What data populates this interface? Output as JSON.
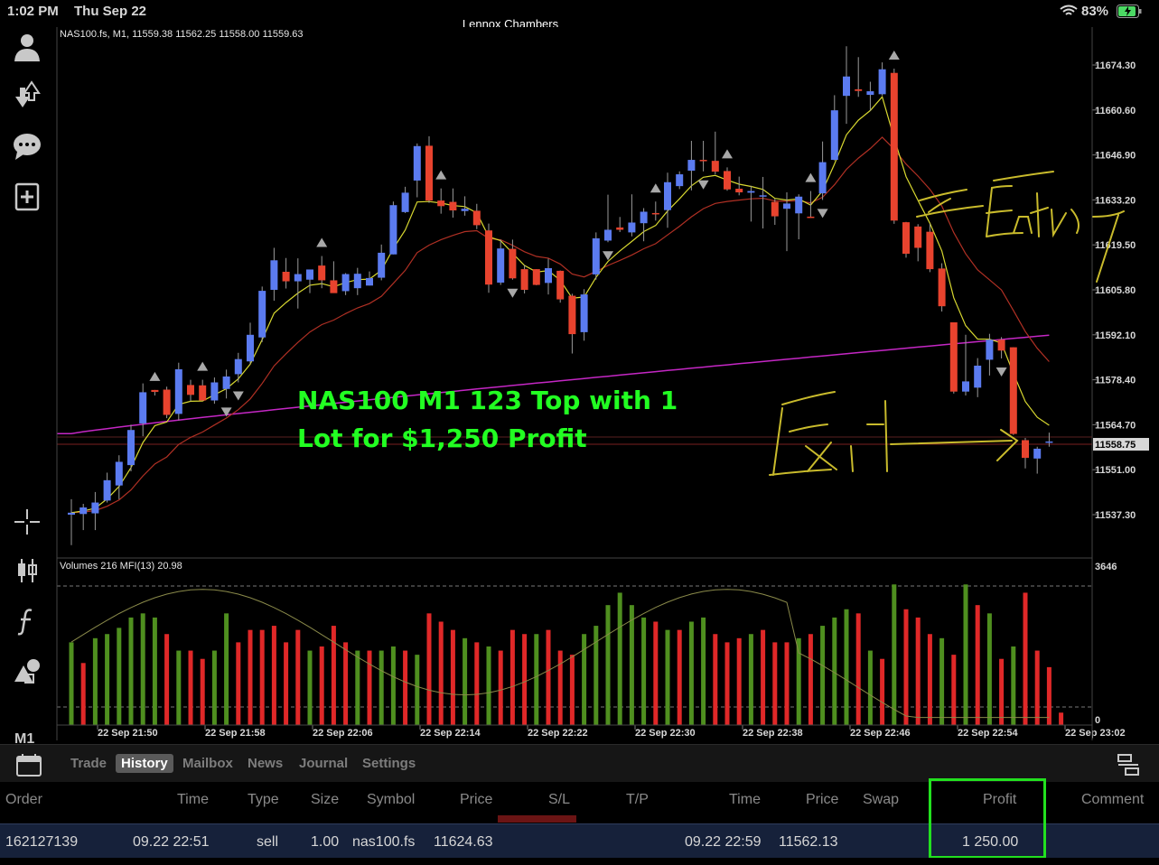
{
  "status_bar": {
    "time": "1:02 PM",
    "date": "Thu Sep 22",
    "user": "Lennox Chambers",
    "battery": "83%"
  },
  "toolbar": {
    "icons": [
      "account-icon",
      "trade-arrows-icon",
      "chat-icon",
      "new-order-icon",
      "crosshair-icon",
      "indicators-icon",
      "function-icon",
      "objects-icon"
    ],
    "timeframe": "M1"
  },
  "chart": {
    "header": "NAS100.fs, M1, 11559.38 11562.25 11558.00 11559.63",
    "indicator_header": "Volumes 216 MFI(13) 20.98",
    "annotation": "NAS100 M1 123 Top with 1 Lot for $1,250 Profit",
    "price_labels": [
      "11674.30",
      "11660.60",
      "11646.90",
      "11633.20",
      "11619.50",
      "11605.80",
      "11592.10",
      "11578.40",
      "11564.70",
      "11551.00",
      "11537.30"
    ],
    "current_price_label": "11558.75",
    "volume_max_label": "3646",
    "volume_zero_label": "0",
    "time_labels": [
      "22 Sep 21:50",
      "22 Sep 21:58",
      "22 Sep 22:06",
      "22 Sep 22:14",
      "22 Sep 22:22",
      "22 Sep 22:30",
      "22 Sep 22:38",
      "22 Sep 22:46",
      "22 Sep 22:54",
      "22 Sep 23:02"
    ],
    "handwriting": [
      "Entry",
      "Exit"
    ],
    "colors": {
      "bull": "#5b7bf0",
      "bear": "#e8432e",
      "ma_fast": "#d8d830",
      "ma_mid": "#b03024",
      "ma_slow": "#c427c4",
      "vol_up": "#4f8f1f",
      "vol_down": "#e02828",
      "annotation": "#22ff22",
      "ink": "#c9bb2c"
    }
  },
  "chart_data": {
    "type": "candlestick",
    "symbol": "NAS100.fs",
    "timeframe": "M1",
    "ylim": [
      11530,
      11680
    ],
    "candles": [
      {
        "o": 11537.3,
        "h": 11542.0,
        "l": 11528.0,
        "c": 11537.9
      },
      {
        "o": 11537.5,
        "h": 11540.6,
        "l": 11532.6,
        "c": 11539.5
      },
      {
        "o": 11537.7,
        "h": 11544.2,
        "l": 11532.6,
        "c": 11541.0
      },
      {
        "o": 11541.6,
        "h": 11550.1,
        "l": 11541.0,
        "c": 11547.8
      },
      {
        "o": 11546.2,
        "h": 11555.4,
        "l": 11542.0,
        "c": 11553.4
      },
      {
        "o": 11552.4,
        "h": 11564.7,
        "l": 11550.5,
        "c": 11563.1
      },
      {
        "o": 11565.1,
        "h": 11577.3,
        "l": 11561.2,
        "c": 11574.6
      },
      {
        "o": 11575.3,
        "h": 11575.3,
        "l": 11573.6,
        "c": 11574.7
      },
      {
        "o": 11575.4,
        "h": 11576.3,
        "l": 11566.7,
        "c": 11567.7
      },
      {
        "o": 11568.0,
        "h": 11583.6,
        "l": 11566.0,
        "c": 11581.6
      },
      {
        "o": 11576.8,
        "h": 11578.4,
        "l": 11571.9,
        "c": 11573.8
      },
      {
        "o": 11576.7,
        "h": 11578.4,
        "l": 11572.0,
        "c": 11572.1
      },
      {
        "o": 11572.1,
        "h": 11579.1,
        "l": 11571.1,
        "c": 11577.6
      },
      {
        "o": 11575.6,
        "h": 11581.5,
        "l": 11572.7,
        "c": 11579.4
      },
      {
        "o": 11580.1,
        "h": 11586.6,
        "l": 11577.6,
        "c": 11584.7
      },
      {
        "o": 11584.0,
        "h": 11595.8,
        "l": 11583.2,
        "c": 11592.1
      },
      {
        "o": 11591.3,
        "h": 11606.8,
        "l": 11589.9,
        "c": 11605.5
      },
      {
        "o": 11605.8,
        "h": 11618.6,
        "l": 11602.5,
        "c": 11614.8
      },
      {
        "o": 11611.3,
        "h": 11615.5,
        "l": 11606.2,
        "c": 11608.4
      },
      {
        "o": 11608.4,
        "h": 11615.4,
        "l": 11600.1,
        "c": 11610.6
      },
      {
        "o": 11608.9,
        "h": 11612.0,
        "l": 11604.8,
        "c": 11612.0
      },
      {
        "o": 11613.2,
        "h": 11616.1,
        "l": 11606.3,
        "c": 11608.7
      },
      {
        "o": 11608.7,
        "h": 11614.5,
        "l": 11605.6,
        "c": 11604.8
      },
      {
        "o": 11605.4,
        "h": 11610.9,
        "l": 11604.2,
        "c": 11610.6
      },
      {
        "o": 11606.3,
        "h": 11612.5,
        "l": 11604.2,
        "c": 11610.7
      },
      {
        "o": 11607.1,
        "h": 11611.4,
        "l": 11607.1,
        "c": 11609.4
      },
      {
        "o": 11609.5,
        "h": 11619.6,
        "l": 11608.7,
        "c": 11617.1
      },
      {
        "o": 11616.6,
        "h": 11632.7,
        "l": 11616.6,
        "c": 11631.6
      },
      {
        "o": 11629.5,
        "h": 11637.2,
        "l": 11629.2,
        "c": 11635.4
      },
      {
        "o": 11639.1,
        "h": 11650.4,
        "l": 11634.0,
        "c": 11649.6
      },
      {
        "o": 11649.7,
        "h": 11652.6,
        "l": 11632.3,
        "c": 11633.0
      },
      {
        "o": 11633.0,
        "h": 11636.7,
        "l": 11629.0,
        "c": 11631.3
      },
      {
        "o": 11632.6,
        "h": 11636.7,
        "l": 11627.8,
        "c": 11630.0
      },
      {
        "o": 11629.8,
        "h": 11634.3,
        "l": 11628.4,
        "c": 11630.5
      },
      {
        "o": 11629.9,
        "h": 11632.0,
        "l": 11624.3,
        "c": 11625.5
      },
      {
        "o": 11623.9,
        "h": 11626.0,
        "l": 11604.9,
        "c": 11607.4
      },
      {
        "o": 11608.0,
        "h": 11621.1,
        "l": 11607.3,
        "c": 11618.4
      },
      {
        "o": 11618.3,
        "h": 11621.1,
        "l": 11608.9,
        "c": 11609.3
      },
      {
        "o": 11612.1,
        "h": 11613.4,
        "l": 11604.7,
        "c": 11605.8
      },
      {
        "o": 11612.1,
        "h": 11612.1,
        "l": 11607.2,
        "c": 11607.3
      },
      {
        "o": 11607.9,
        "h": 11615.3,
        "l": 11604.4,
        "c": 11612.4
      },
      {
        "o": 11611.6,
        "h": 11611.7,
        "l": 11601.9,
        "c": 11602.9
      },
      {
        "o": 11604.0,
        "h": 11604.6,
        "l": 11586.4,
        "c": 11592.3
      },
      {
        "o": 11592.9,
        "h": 11606.0,
        "l": 11590.3,
        "c": 11604.4
      },
      {
        "o": 11610.5,
        "h": 11623.3,
        "l": 11608.9,
        "c": 11621.5
      },
      {
        "o": 11620.8,
        "h": 11634.8,
        "l": 11620.3,
        "c": 11624.1
      },
      {
        "o": 11624.8,
        "h": 11628.0,
        "l": 11623.4,
        "c": 11624.1
      },
      {
        "o": 11623.3,
        "h": 11634.9,
        "l": 11622.1,
        "c": 11626.3
      },
      {
        "o": 11626.1,
        "h": 11630.7,
        "l": 11620.6,
        "c": 11629.6
      },
      {
        "o": 11629.2,
        "h": 11632.7,
        "l": 11626.9,
        "c": 11629.1
      },
      {
        "o": 11630.1,
        "h": 11641.5,
        "l": 11624.7,
        "c": 11638.6
      },
      {
        "o": 11637.4,
        "h": 11641.9,
        "l": 11636.5,
        "c": 11641.0
      },
      {
        "o": 11642.1,
        "h": 11651.2,
        "l": 11636.1,
        "c": 11645.4
      },
      {
        "o": 11645.4,
        "h": 11651.2,
        "l": 11641.9,
        "c": 11645.3
      },
      {
        "o": 11645.1,
        "h": 11654.0,
        "l": 11641.0,
        "c": 11641.8
      },
      {
        "o": 11642.0,
        "h": 11643.1,
        "l": 11636.0,
        "c": 11636.4
      },
      {
        "o": 11636.6,
        "h": 11640.3,
        "l": 11634.6,
        "c": 11635.5
      },
      {
        "o": 11635.4,
        "h": 11637.5,
        "l": 11626.6,
        "c": 11635.9
      },
      {
        "o": 11634.4,
        "h": 11640.2,
        "l": 11624.5,
        "c": 11634.6
      },
      {
        "o": 11632.6,
        "h": 11633.5,
        "l": 11625.6,
        "c": 11628.2
      },
      {
        "o": 11630.5,
        "h": 11635.5,
        "l": 11617.6,
        "c": 11632.1
      },
      {
        "o": 11629.1,
        "h": 11634.9,
        "l": 11621.2,
        "c": 11634.2
      },
      {
        "o": 11628.1,
        "h": 11635.9,
        "l": 11627.7,
        "c": 11627.9
      },
      {
        "o": 11635.2,
        "h": 11651.0,
        "l": 11633.2,
        "c": 11644.7
      },
      {
        "o": 11645.4,
        "h": 11665.1,
        "l": 11645.2,
        "c": 11660.5
      },
      {
        "o": 11664.9,
        "h": 11680.0,
        "l": 11656.4,
        "c": 11670.8
      },
      {
        "o": 11666.9,
        "h": 11676.7,
        "l": 11664.6,
        "c": 11666.4
      },
      {
        "o": 11665.2,
        "h": 11669.2,
        "l": 11660.4,
        "c": 11666.3
      },
      {
        "o": 11665.4,
        "h": 11675.1,
        "l": 11665.0,
        "c": 11673.0
      },
      {
        "o": 11671.9,
        "h": 11673.2,
        "l": 11625.9,
        "c": 11626.9
      },
      {
        "o": 11626.4,
        "h": 11626.5,
        "l": 11615.6,
        "c": 11616.8
      },
      {
        "o": 11625.1,
        "h": 11625.8,
        "l": 11614.5,
        "c": 11618.6
      },
      {
        "o": 11623.5,
        "h": 11625.9,
        "l": 11611.2,
        "c": 11612.1
      },
      {
        "o": 11612.3,
        "h": 11613.9,
        "l": 11599.2,
        "c": 11600.8
      },
      {
        "o": 11595.9,
        "h": 11595.9,
        "l": 11574.2,
        "c": 11574.8
      },
      {
        "o": 11574.8,
        "h": 11592.1,
        "l": 11573.6,
        "c": 11577.9
      },
      {
        "o": 11576.0,
        "h": 11585.0,
        "l": 11573.1,
        "c": 11582.7
      },
      {
        "o": 11584.5,
        "h": 11592.4,
        "l": 11579.7,
        "c": 11590.6
      },
      {
        "o": 11590.6,
        "h": 11591.4,
        "l": 11584.9,
        "c": 11587.3
      },
      {
        "o": 11588.3,
        "h": 11588.3,
        "l": 11561.6,
        "c": 11561.9
      },
      {
        "o": 11560.0,
        "h": 11560.7,
        "l": 11551.4,
        "c": 11554.6
      },
      {
        "o": 11554.4,
        "h": 11558.0,
        "l": 11549.8,
        "c": 11557.4
      },
      {
        "o": 11559.4,
        "h": 11562.3,
        "l": 11558.0,
        "c": 11559.6
      }
    ],
    "volume_ylim": [
      0,
      3646
    ],
    "volumes": [
      2000,
      1500,
      2100,
      2200,
      2350,
      2600,
      2700,
      2600,
      2200,
      1800,
      1800,
      1600,
      1800,
      2700,
      2000,
      2300,
      2300,
      2400,
      2000,
      2300,
      1800,
      1900,
      2400,
      2000,
      1800,
      1800,
      1800,
      1900,
      1800,
      1700,
      2700,
      2500,
      2300,
      2100,
      2000,
      1900,
      1800,
      2300,
      2200,
      2200,
      2300,
      1800,
      1700,
      2200,
      2400,
      2900,
      3200,
      2900,
      2600,
      2500,
      2300,
      2300,
      2500,
      2600,
      2200,
      2000,
      2100,
      2200,
      2300,
      2000,
      2000,
      2100,
      2200,
      2400,
      2600,
      2800,
      2700,
      1800,
      1600,
      3400,
      2800,
      2600,
      2200,
      2100,
      1700,
      3400,
      2900,
      2700,
      1600,
      1900,
      3200,
      1800,
      1400,
      300
    ],
    "volume_directions": [
      "up",
      "down",
      "up",
      "up",
      "up",
      "up",
      "up",
      "up",
      "down",
      "up",
      "down",
      "down",
      "up",
      "up",
      "down",
      "down",
      "down",
      "down",
      "down",
      "down",
      "up",
      "down",
      "down",
      "down",
      "up",
      "down",
      "up",
      "up",
      "down",
      "up",
      "down",
      "down",
      "down",
      "up",
      "down",
      "up",
      "down",
      "down",
      "down",
      "up",
      "down",
      "down",
      "down",
      "up",
      "up",
      "up",
      "up",
      "up",
      "up",
      "down",
      "up",
      "down",
      "up",
      "up",
      "down",
      "down",
      "down",
      "up",
      "down",
      "down",
      "down",
      "up",
      "down",
      "up",
      "up",
      "up",
      "down",
      "up",
      "down",
      "up",
      "down",
      "down",
      "down",
      "up",
      "down",
      "up",
      "down",
      "up",
      "down",
      "up",
      "down",
      "down",
      "down",
      "down"
    ]
  },
  "tabs": [
    {
      "label": "Trade",
      "active": false
    },
    {
      "label": "History",
      "active": true
    },
    {
      "label": "Mailbox",
      "active": false
    },
    {
      "label": "News",
      "active": false
    },
    {
      "label": "Journal",
      "active": false
    },
    {
      "label": "Settings",
      "active": false
    }
  ],
  "history": {
    "columns": [
      "Order",
      "Time",
      "Type",
      "Size",
      "Symbol",
      "Price",
      "S/L",
      "T/P",
      "Time",
      "Price",
      "Swap",
      "Profit",
      "Comment"
    ],
    "row": [
      "162127139",
      "09.22 22:51",
      "sell",
      "1.00",
      "nas100.fs",
      "11624.63",
      "",
      "",
      "09.22 22:59",
      "11562.13",
      "",
      "1 250.00",
      ""
    ]
  }
}
